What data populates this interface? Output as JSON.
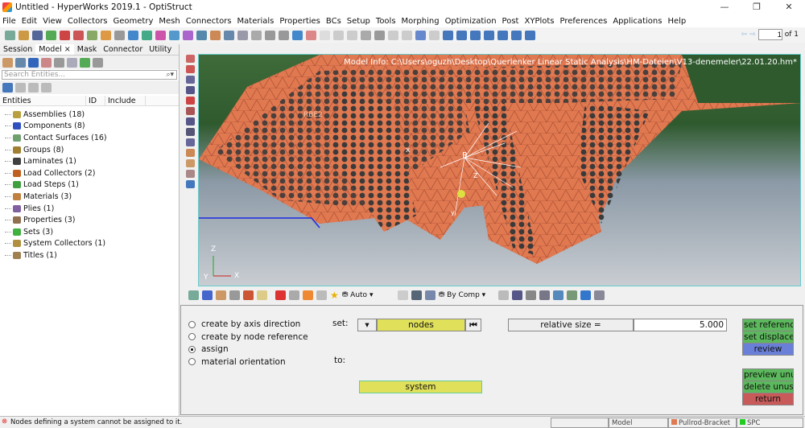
{
  "window": {
    "title": "Untitled - HyperWorks 2019.1 - OptiStruct",
    "minimize": "—",
    "maximize": "❐",
    "close": "✕"
  },
  "menu": [
    "File",
    "Edit",
    "View",
    "Collectors",
    "Geometry",
    "Mesh",
    "Connectors",
    "Materials",
    "Properties",
    "BCs",
    "Setup",
    "Tools",
    "Morphing",
    "Optimization",
    "Post",
    "XYPlots",
    "Preferences",
    "Applications",
    "Help"
  ],
  "pager": {
    "page": "1",
    "of": "of 1"
  },
  "left": {
    "tabs": [
      "Session",
      "Model ×",
      "Mask",
      "Connector",
      "Utility"
    ],
    "search_placeholder": "Search Entities...",
    "columns": [
      "Entities",
      "ID",
      "Include"
    ],
    "items": [
      {
        "label": "Assemblies (18)",
        "color": "#b8a040"
      },
      {
        "label": "Components (8)",
        "color": "#3050c0"
      },
      {
        "label": "Contact Surfaces (16)",
        "color": "#70a070"
      },
      {
        "label": "Groups (8)",
        "color": "#a08030"
      },
      {
        "label": "Laminates (1)",
        "color": "#404040"
      },
      {
        "label": "Load Collectors (2)",
        "color": "#c06020"
      },
      {
        "label": "Load Steps (1)",
        "color": "#40a040"
      },
      {
        "label": "Materials (3)",
        "color": "#c08040"
      },
      {
        "label": "Plies (1)",
        "color": "#8060a0"
      },
      {
        "label": "Properties (3)",
        "color": "#907050"
      },
      {
        "label": "Sets (3)",
        "color": "#40b040"
      },
      {
        "label": "System Collectors (1)",
        "color": "#b09040"
      },
      {
        "label": "Titles (1)",
        "color": "#a08050"
      }
    ]
  },
  "viewport": {
    "model_info": "Model Info: C:\\Users\\oguzh\\Desktop\\Querlenker Linear Static Analysis\\HM-Dateien\\V13-denemeler\\22.01.20.hm*",
    "labels": {
      "rbe2": "RBE2",
      "x": "x",
      "r": "R",
      "z": "Z",
      "y": "y"
    },
    "axes": {
      "z": "Z",
      "y": "Y",
      "x": "X"
    }
  },
  "viewtoolbar": {
    "display_mode": "Auto",
    "color_mode": "By Comp"
  },
  "panel": {
    "radios": [
      {
        "label": "create by axis direction",
        "selected": false
      },
      {
        "label": "create by node reference",
        "selected": false
      },
      {
        "label": "assign",
        "selected": true
      },
      {
        "label": "material orientation",
        "selected": false
      }
    ],
    "set_label": "set:",
    "to_label": "to:",
    "nodes": "nodes",
    "system": "system",
    "relative_size_label": "relative size =",
    "relative_size_value": "5.000",
    "buttons": {
      "set_reference": "set reference",
      "set_displacement": "set displacement",
      "review": "review",
      "preview_unused": "preview unused",
      "delete_unused": "delete unused",
      "return": "return"
    }
  },
  "status": {
    "message": "Nodes defining a system cannot be assigned to it.",
    "model": "Model",
    "component": "Pullrod-Bracket",
    "loadcol": "SPC"
  },
  "colors": {
    "mesh": "#e07850",
    "node": "#3a3a3a",
    "review": "#6a80d8",
    "return": "#c85a5a",
    "green": "#5cb85c",
    "yellow": "#e0e05a"
  }
}
